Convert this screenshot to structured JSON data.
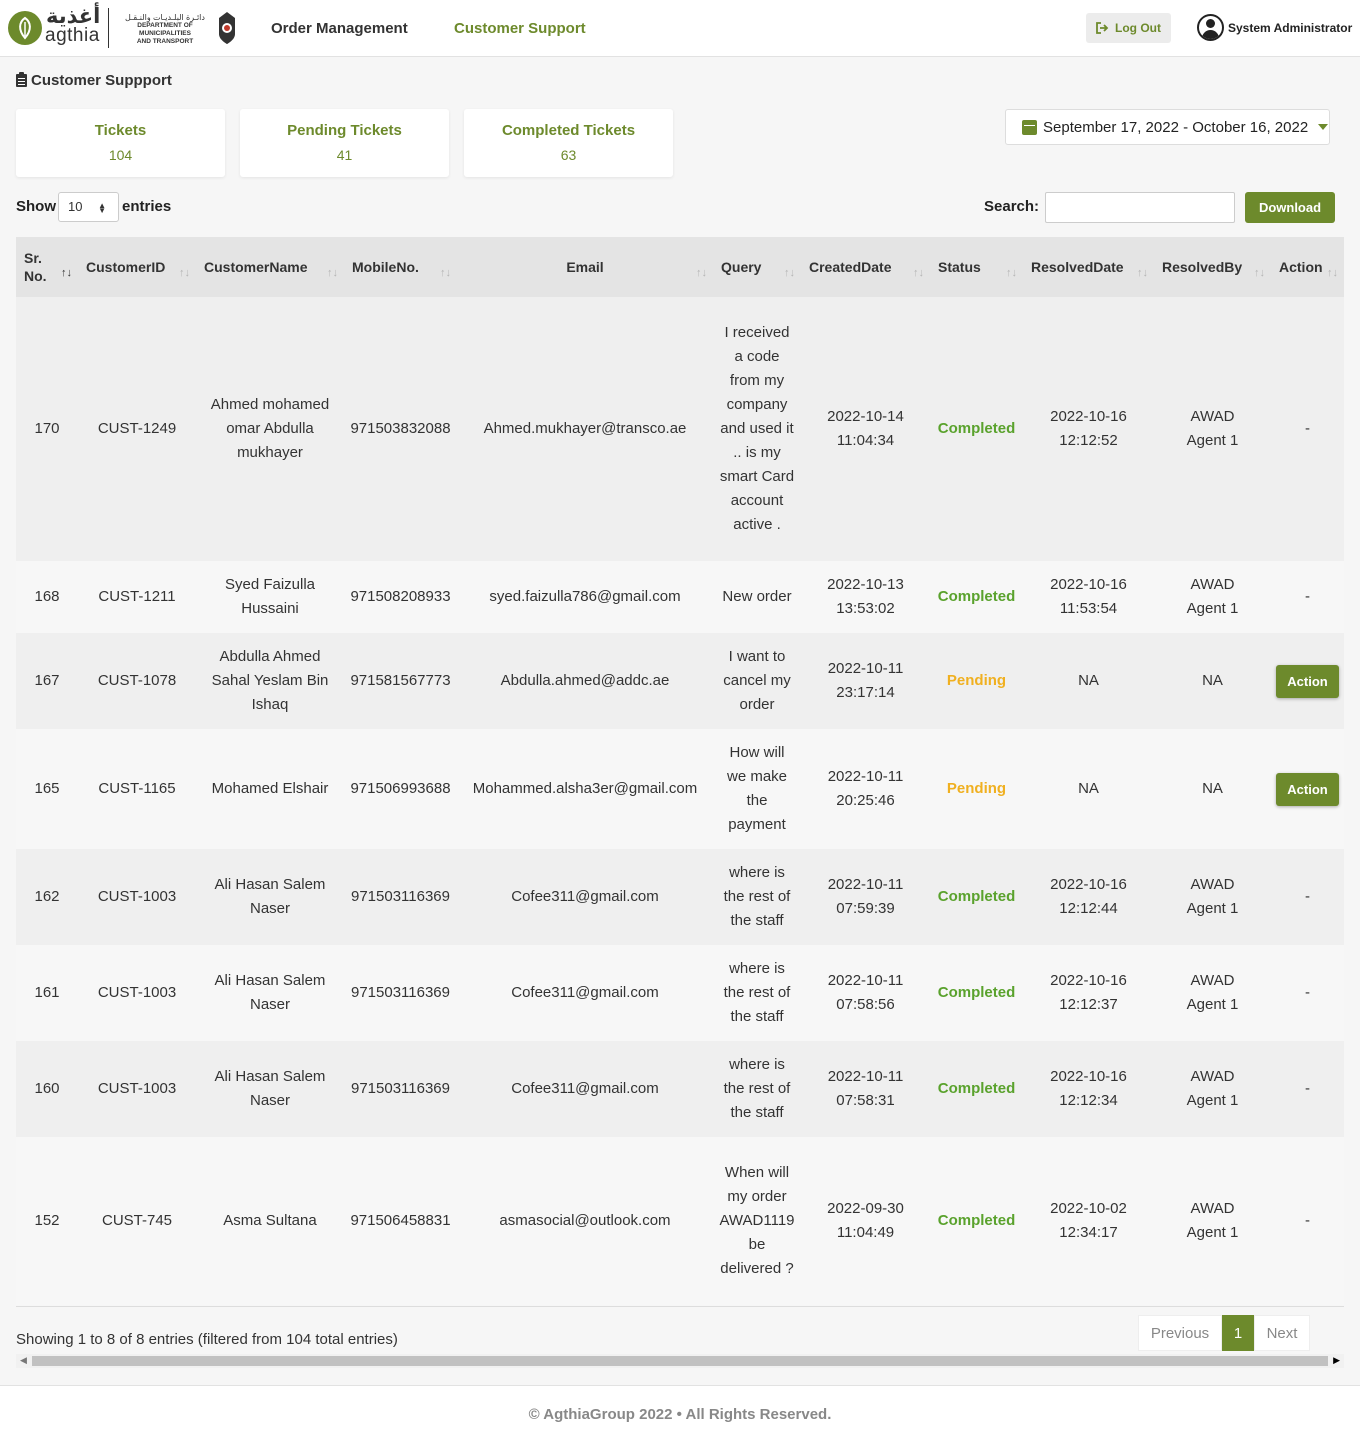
{
  "header": {
    "logo_arabic": "أغذية",
    "logo_text": "agthia",
    "dept_arabic": "دائـرة البلـديـات والنـقـل",
    "dept_line1": "DEPARTMENT OF MUNICIPALITIES",
    "dept_line2": "AND TRANSPORT",
    "nav": [
      "Order Management",
      "Customer Support"
    ],
    "active_nav": "Customer Support",
    "logout_label": "Log Out",
    "user_name": "System Administrator"
  },
  "page": {
    "title": "Customer Suppport"
  },
  "stats": [
    {
      "label": "Tickets",
      "value": "104"
    },
    {
      "label": "Pending Tickets",
      "value": "41"
    },
    {
      "label": "Completed Tickets",
      "value": "63"
    }
  ],
  "date_range": "September 17, 2022 - October 16, 2022",
  "controls": {
    "show_label": "Show",
    "entries_value": "10",
    "entries_label": "entries",
    "search_label": "Search:",
    "search_value": "",
    "download_label": "Download"
  },
  "table": {
    "columns": [
      "Sr. No.",
      "CustomerID",
      "CustomerName",
      "MobileNo.",
      "Email",
      "Query",
      "CreatedDate",
      "Status",
      "ResolvedDate",
      "ResolvedBy",
      "Action"
    ],
    "rows": [
      {
        "sr": "170",
        "cid": "CUST-1249",
        "name": "Ahmed mohamed omar Abdulla mukhayer",
        "mobile": "971503832088",
        "email": "Ahmed.mukhayer@transco.ae",
        "query": "I received a code from my company and used it .. is my smart Card account active .",
        "created_date": "2022-10-14",
        "created_time": "11:04:34",
        "status": "Completed",
        "resolved_date": "2022-10-16",
        "resolved_time": "12:12:52",
        "resolved_by": "AWAD Agent 1",
        "action": "-"
      },
      {
        "sr": "168",
        "cid": "CUST-1211",
        "name": "Syed Faizulla Hussaini",
        "mobile": "971508208933",
        "email": "syed.faizulla786@gmail.com",
        "query": "New order",
        "created_date": "2022-10-13",
        "created_time": "13:53:02",
        "status": "Completed",
        "resolved_date": "2022-10-16",
        "resolved_time": "11:53:54",
        "resolved_by": "AWAD Agent 1",
        "action": "-"
      },
      {
        "sr": "167",
        "cid": "CUST-1078",
        "name": "Abdulla Ahmed Sahal Yeslam Bin Ishaq",
        "mobile": "971581567773",
        "email": "Abdulla.ahmed@addc.ae",
        "query": "I want to cancel my order",
        "created_date": "2022-10-11",
        "created_time": "23:17:14",
        "status": "Pending",
        "resolved_date": "NA",
        "resolved_time": "",
        "resolved_by": "NA",
        "action": "Action"
      },
      {
        "sr": "165",
        "cid": "CUST-1165",
        "name": "Mohamed Elshair",
        "mobile": "971506993688",
        "email": "Mohammed.alsha3er@gmail.com",
        "query": "How will we make the payment",
        "created_date": "2022-10-11",
        "created_time": "20:25:46",
        "status": "Pending",
        "resolved_date": "NA",
        "resolved_time": "",
        "resolved_by": "NA",
        "action": "Action"
      },
      {
        "sr": "162",
        "cid": "CUST-1003",
        "name": "Ali Hasan Salem Naser",
        "mobile": "971503116369",
        "email": "Cofee311@gmail.com",
        "query": "where is the rest of the staff",
        "created_date": "2022-10-11",
        "created_time": "07:59:39",
        "status": "Completed",
        "resolved_date": "2022-10-16",
        "resolved_time": "12:12:44",
        "resolved_by": "AWAD Agent 1",
        "action": "-"
      },
      {
        "sr": "161",
        "cid": "CUST-1003",
        "name": "Ali Hasan Salem Naser",
        "mobile": "971503116369",
        "email": "Cofee311@gmail.com",
        "query": "where is the rest of the staff",
        "created_date": "2022-10-11",
        "created_time": "07:58:56",
        "status": "Completed",
        "resolved_date": "2022-10-16",
        "resolved_time": "12:12:37",
        "resolved_by": "AWAD Agent 1",
        "action": "-"
      },
      {
        "sr": "160",
        "cid": "CUST-1003",
        "name": "Ali Hasan Salem Naser",
        "mobile": "971503116369",
        "email": "Cofee311@gmail.com",
        "query": "where is the rest of the staff",
        "created_date": "2022-10-11",
        "created_time": "07:58:31",
        "status": "Completed",
        "resolved_date": "2022-10-16",
        "resolved_time": "12:12:34",
        "resolved_by": "AWAD Agent 1",
        "action": "-"
      },
      {
        "sr": "152",
        "cid": "CUST-745",
        "name": "Asma Sultana",
        "mobile": "971506458831",
        "email": "asmasocial@outlook.com",
        "query": "When will my order AWAD1119 be delivered ?",
        "created_date": "2022-09-30",
        "created_time": "11:04:49",
        "status": "Completed",
        "resolved_date": "2022-10-02",
        "resolved_time": "12:34:17",
        "resolved_by": "AWAD Agent 1",
        "action": "-"
      }
    ]
  },
  "pagination": {
    "info": "Showing 1 to 8 of 8 entries (filtered from 104 total entries)",
    "previous": "Previous",
    "current": "1",
    "next": "Next"
  },
  "footer": "© AgthiaGroup 2022 • All Rights Reserved.",
  "colors": {
    "brand": "#6d8a2c",
    "completed": "#5aa22d",
    "pending": "#f0b020"
  }
}
